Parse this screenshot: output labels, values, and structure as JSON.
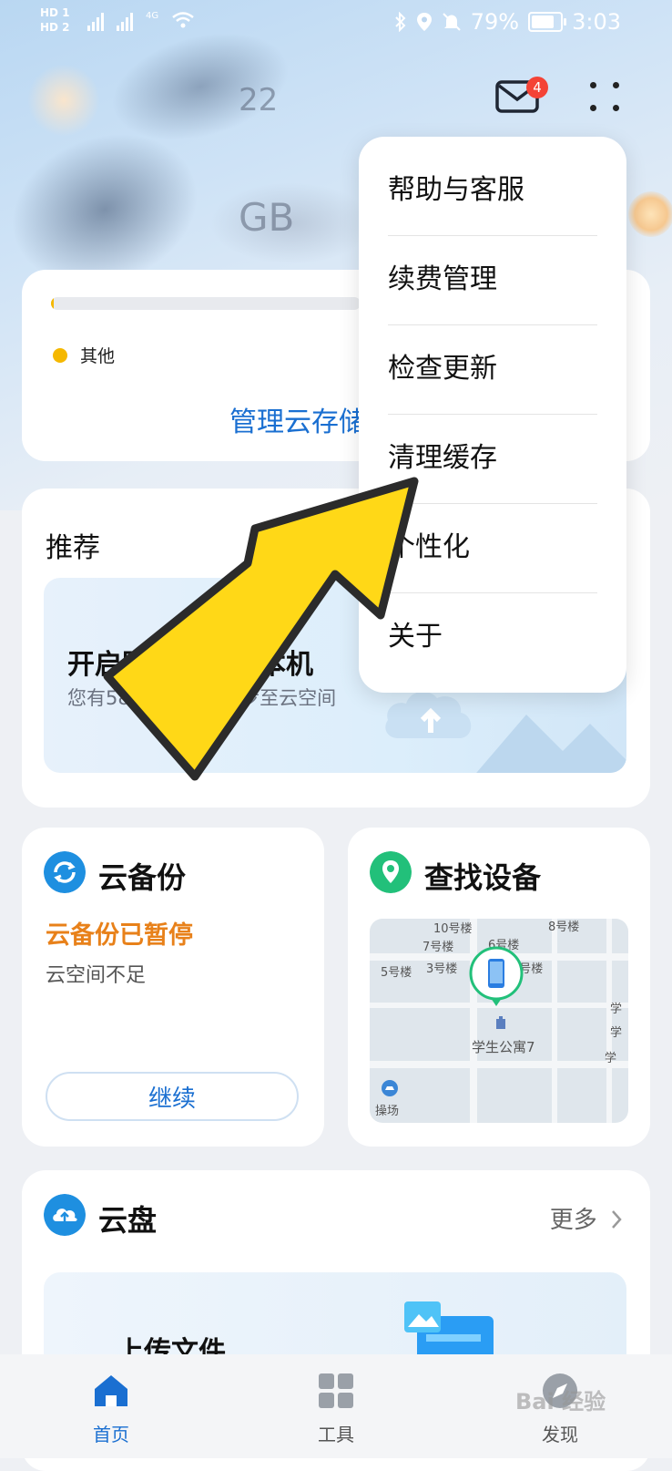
{
  "status_bar": {
    "sim1": "HD 1",
    "sim2": "HD 2",
    "network": "4G",
    "battery": "79%",
    "battery_level": 0.79,
    "time": "3:03"
  },
  "hero": {
    "number_hint": "22",
    "unit_hint": "GB"
  },
  "header": {
    "mail_badge": "4"
  },
  "storage": {
    "legend_other": "其他",
    "manage_link": "管理云存储",
    "usage_fraction": 0.01
  },
  "recommend": {
    "title": "推荐",
    "headline": "开启图库，释放本机",
    "subtitle": "您有58 GB照片未同步至云空间"
  },
  "backup": {
    "title": "云备份",
    "status": "云备份已暂停",
    "reason": "云空间不足",
    "continue_label": "继续"
  },
  "find_device": {
    "title": "查找设备",
    "map_labels": [
      "10号楼",
      "8号楼",
      "7号楼",
      "6号楼",
      "5号楼",
      "3号楼",
      "2号楼",
      "学生公寓7",
      "操场",
      "学",
      "学",
      "学"
    ]
  },
  "drive": {
    "title": "云盘",
    "more_label": "更多",
    "upload_label": "上传文件"
  },
  "menu": {
    "items": [
      "帮助与客服",
      "续费管理",
      "检查更新",
      "清理缓存",
      "个性化",
      "关于"
    ]
  },
  "tabs": [
    {
      "label": "首页",
      "icon": "home-icon"
    },
    {
      "label": "工具",
      "icon": "grid-icon"
    },
    {
      "label": "发现",
      "icon": "discover-icon"
    }
  ],
  "watermark": "Bai 经验",
  "colors": {
    "accent": "#1a6fd1",
    "warning": "#e8811a",
    "arrow_fill": "#ffd817",
    "arrow_outline": "#2b2b2b",
    "badge": "#f44336"
  }
}
